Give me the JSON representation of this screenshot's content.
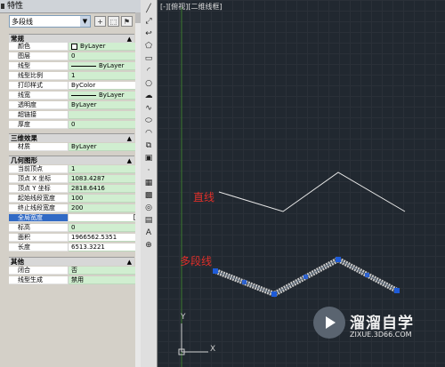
{
  "panel": {
    "title": "特性",
    "selector_value": "多段线",
    "sections": {
      "general": "常规",
      "three_d": "三维效果",
      "geometry": "几何图形",
      "misc": "其他"
    },
    "general_rows": [
      {
        "label": "颜色",
        "value": "ByLayer"
      },
      {
        "label": "图层",
        "value": "0"
      },
      {
        "label": "线型",
        "value": "ByLayer"
      },
      {
        "label": "线型比例",
        "value": "1"
      },
      {
        "label": "打印样式",
        "value": "ByColor"
      },
      {
        "label": "线宽",
        "value": "ByLayer"
      },
      {
        "label": "透明度",
        "value": "ByLayer"
      },
      {
        "label": "超链接",
        "value": ""
      },
      {
        "label": "厚度",
        "value": "0"
      }
    ],
    "three_d_rows": [
      {
        "label": "材质",
        "value": "ByLayer"
      }
    ],
    "geometry_rows": [
      {
        "label": "当前顶点",
        "value": "1"
      },
      {
        "label": "顶点 X 坐标",
        "value": "1083.4287"
      },
      {
        "label": "顶点 Y 坐标",
        "value": "2818.6416"
      },
      {
        "label": "起始线段宽度",
        "value": "100"
      },
      {
        "label": "终止线段宽度",
        "value": "200"
      },
      {
        "label": "全局宽度",
        "value": ""
      },
      {
        "label": "标高",
        "value": "0"
      },
      {
        "label": "面积",
        "value": "1966562.5351"
      },
      {
        "label": "长度",
        "value": "6513.3221"
      }
    ],
    "misc_rows": [
      {
        "label": "闭合",
        "value": "否"
      },
      {
        "label": "线型生成",
        "value": "禁用"
      }
    ]
  },
  "viewport": {
    "label": "[-][俯视][二维线框]"
  },
  "canvas": {
    "label_line": "直线",
    "label_polyline": "多段线",
    "ucs_y": "Y",
    "ucs_x": "X"
  },
  "watermark": {
    "name": "溜溜自学",
    "url": "ZIXUE.3D66.COM"
  },
  "colors": {
    "accent_red": "#e0302a",
    "grip_blue": "#1e5bd8",
    "selected_row": "#316ac5",
    "value_green": "#d0eed0"
  }
}
